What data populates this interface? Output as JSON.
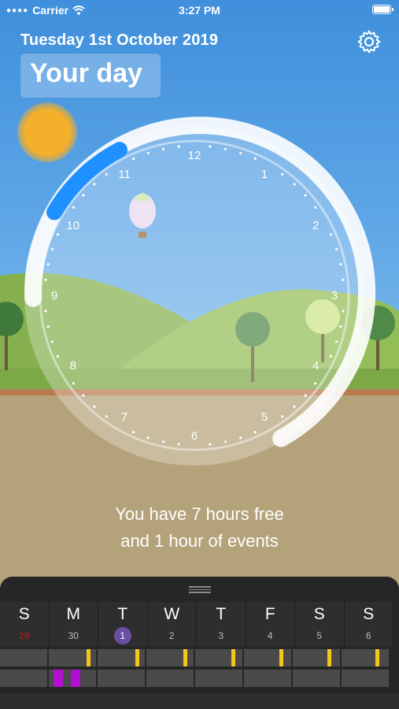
{
  "status_bar": {
    "carrier": "Carrier",
    "time": "3:27 PM"
  },
  "header": {
    "date": "Tuesday 1st October 2019",
    "title": "Your day"
  },
  "clock": {
    "numbers": [
      "12",
      "1",
      "2",
      "3",
      "4",
      "5",
      "6",
      "7",
      "8",
      "9",
      "10",
      "11"
    ]
  },
  "summary": {
    "line1": "You have 7 hours free",
    "line2": "and 1 hour of events"
  },
  "week": {
    "days": [
      {
        "letter": "S",
        "date": "29"
      },
      {
        "letter": "M",
        "date": "30"
      },
      {
        "letter": "T",
        "date": "1"
      },
      {
        "letter": "W",
        "date": "2"
      },
      {
        "letter": "T",
        "date": "3"
      },
      {
        "letter": "F",
        "date": "4"
      },
      {
        "letter": "S",
        "date": "5"
      },
      {
        "letter": "S",
        "date": "6"
      }
    ]
  },
  "colors": {
    "sky": "#4a96dc",
    "hills": "#8fb85a",
    "ground": "#b4a27a",
    "panel": "#262626",
    "accent": "#1e90ff",
    "today": "#6a4fa3",
    "event": "#b20fd0",
    "free_marker": "#f5c518"
  },
  "icons": {
    "settings": "gear-icon",
    "wifi": "wifi-icon",
    "battery": "battery-icon"
  }
}
